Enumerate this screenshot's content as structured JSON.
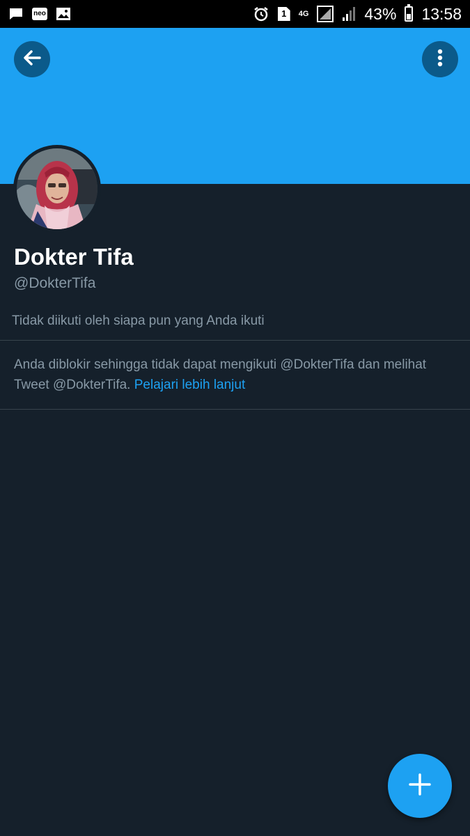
{
  "status_bar": {
    "left_icons": [
      "chat-bubble-icon",
      "neo-app-icon",
      "image-icon"
    ],
    "neo_label": "neo",
    "sim_label": "1",
    "network_label": "4G",
    "battery": "43%",
    "battery_level": 0.43,
    "time": "13:58"
  },
  "header": {
    "back_icon": "arrow-left-icon",
    "more_icon": "more-vertical-icon",
    "banner_color": "#1da1f2"
  },
  "profile": {
    "display_name": "Dokter Tifa",
    "handle": "@DokterTifa",
    "followers_note": "Tidak diikuti oleh siapa pun yang Anda ikuti",
    "blocked_message": "Anda diblokir sehingga tidak dapat mengikuti @DokterTifa dan melihat Tweet @DokterTifa.",
    "learn_more": "Pelajari lebih lanjut"
  },
  "fab": {
    "icon": "plus-icon"
  },
  "colors": {
    "background": "#15202b",
    "accent": "#1da1f2",
    "secondary_text": "#8899a6",
    "divider": "#38444d"
  }
}
